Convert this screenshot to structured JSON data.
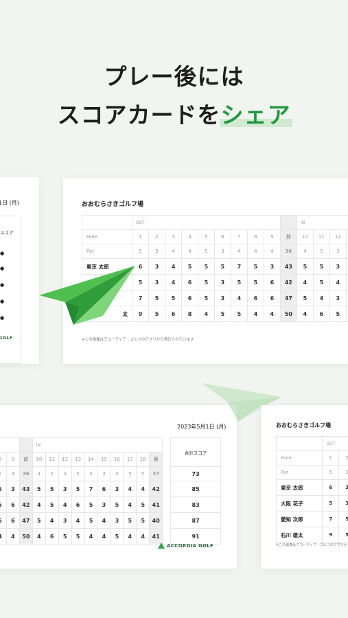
{
  "headline": {
    "line1": "プレー後には",
    "line2_prefix": "スコアカードを",
    "line2_highlight": "シェア"
  },
  "accent_color": "#1f9a3e",
  "course_name": "おおむらさきゴルフ場",
  "date": "2023年5月1日 (月)",
  "date_partial": "1日 (月)",
  "total_label": "合計スコア",
  "total_label_partial": "スコア",
  "note": "※この画像はアコーディア・ゴルフのアプリから発行されています",
  "brand": "ACCORDIA GOLF",
  "brand_partial": "GOLF",
  "out_label": "OUT",
  "in_label": "IN",
  "hole_label": "Hole",
  "par_label": "Par",
  "players": [
    "東京 太郎",
    "大阪 花子",
    "愛知 次郎",
    "石川 雄太"
  ],
  "partial_name_tail": "太",
  "top_card": {
    "holes": [
      "1",
      "2",
      "3",
      "4",
      "5",
      "6",
      "7",
      "8",
      "9",
      "前",
      "10",
      "11",
      "12",
      "13"
    ],
    "par": [
      "5",
      "3",
      "4",
      "4",
      "5",
      "3",
      "4",
      "4",
      "4",
      "36",
      "4",
      "5",
      "3",
      "5"
    ],
    "rows": [
      [
        "6",
        "3",
        "4",
        "5",
        "5",
        "5",
        "7",
        "5",
        "3",
        "43",
        "5",
        "5",
        "3",
        "5"
      ],
      [
        "5",
        "3",
        "4",
        "6",
        "5",
        "3",
        "5",
        "5",
        "6",
        "42",
        "4",
        "5",
        "4",
        "6"
      ],
      [
        "7",
        "5",
        "5",
        "6",
        "5",
        "3",
        "4",
        "6",
        "6",
        "47",
        "5",
        "4",
        "3",
        "4"
      ],
      [
        "9",
        "5",
        "6",
        "8",
        "4",
        "5",
        "5",
        "4",
        "4",
        "50",
        "4",
        "6",
        "5",
        "5"
      ]
    ]
  },
  "bottom_card": {
    "holes": [
      "8",
      "9",
      "前",
      "10",
      "11",
      "12",
      "13",
      "14",
      "15",
      "16",
      "17",
      "18",
      "後"
    ],
    "par": [
      "5",
      "4",
      "36",
      "4",
      "5",
      "3",
      "5",
      "4",
      "3",
      "3",
      "5",
      "5",
      "37"
    ],
    "totals": [
      "73",
      "85",
      "83",
      "87",
      "91"
    ],
    "rows": [
      [
        "5",
        "3",
        "43",
        "5",
        "5",
        "3",
        "5",
        "7",
        "6",
        "3",
        "4",
        "4",
        "42"
      ],
      [
        "5",
        "6",
        "42",
        "4",
        "5",
        "4",
        "6",
        "5",
        "3",
        "5",
        "4",
        "5",
        "41"
      ],
      [
        "6",
        "6",
        "47",
        "5",
        "4",
        "3",
        "4",
        "5",
        "4",
        "3",
        "5",
        "5",
        "40"
      ],
      [
        "4",
        "4",
        "50",
        "4",
        "6",
        "5",
        "5",
        "4",
        "4",
        "5",
        "4",
        "4",
        "41"
      ]
    ]
  },
  "right_card": {
    "holes": [
      "1",
      "2"
    ],
    "par": [
      "5",
      "3"
    ],
    "rows": [
      [
        "6",
        "3"
      ],
      [
        "5",
        "3"
      ],
      [
        "7",
        "5"
      ],
      [
        "9",
        "5"
      ]
    ]
  },
  "left_card_dots": [
    "●",
    "●",
    "●",
    "●",
    "●"
  ]
}
